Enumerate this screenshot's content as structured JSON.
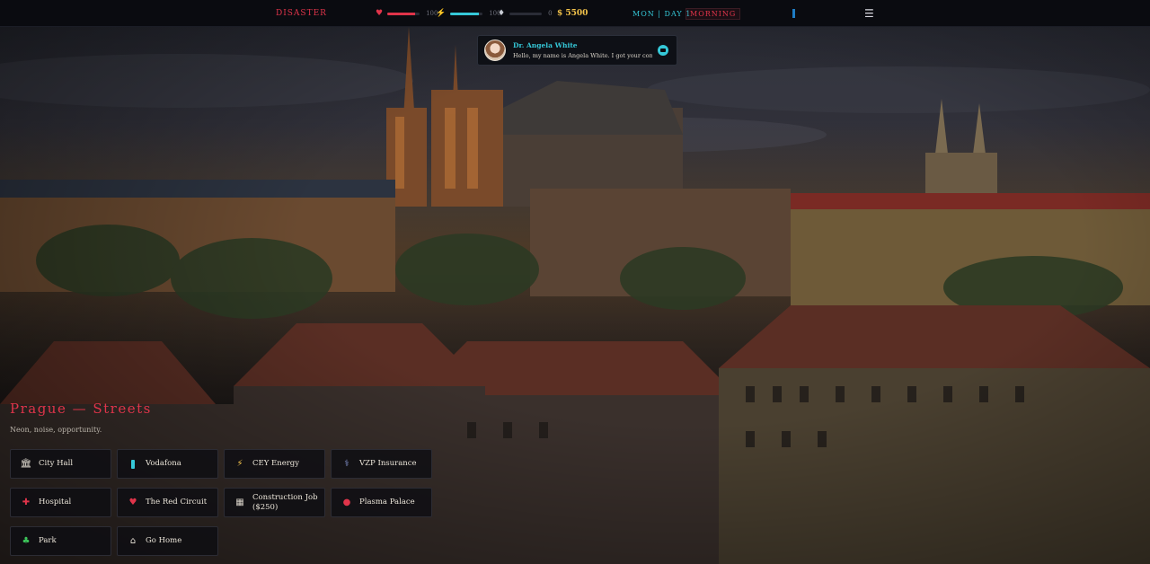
{
  "hud": {
    "brand": "DISASTER",
    "health": {
      "icon": "heart-icon",
      "value": "100",
      "fill": 0.85,
      "color": "#e0344a"
    },
    "energy": {
      "icon": "lightning-icon",
      "value": "100",
      "fill": 0.88,
      "color": "#35c8d8"
    },
    "karma": {
      "icon": "diamond-icon",
      "value": "0",
      "fill": 0.0,
      "color": "#9aa0aa"
    },
    "money": "$ 5500",
    "date": "MON | DAY 1",
    "time_of_day": "MORNING"
  },
  "notification": {
    "name": "Dr. Angela White",
    "message": "Hello, my name is Angela White. I got your contac..."
  },
  "location": {
    "title": "Prague — Streets",
    "subtitle": "Neon, noise, opportunity."
  },
  "actions": [
    {
      "label": "City Hall",
      "icon": "building-icon",
      "icon_color": "#e8e2d8"
    },
    {
      "label": "Vodafona",
      "icon": "phone-icon",
      "icon_color": "#35c8d8"
    },
    {
      "label": "CEY Energy",
      "icon": "lightning-icon",
      "icon_color": "#f2c24a"
    },
    {
      "label": "VZP Insurance",
      "icon": "stethoscope-icon",
      "icon_color": "#8a9ad8"
    },
    {
      "label": "Hospital",
      "icon": "hospital-icon",
      "icon_color": "#e0344a"
    },
    {
      "label": "The Red Circuit",
      "icon": "heart-icon",
      "icon_color": "#e0344a"
    },
    {
      "label": "Construction Job ($250)",
      "icon": "factory-icon",
      "icon_color": "#d8d2c8"
    },
    {
      "label": "Plasma Palace",
      "icon": "blood-drop-icon",
      "icon_color": "#e0344a"
    },
    {
      "label": "Park",
      "icon": "tree-icon",
      "icon_color": "#3cc45a"
    },
    {
      "label": "Go Home",
      "icon": "home-icon",
      "icon_color": "#e8e2d8"
    }
  ]
}
